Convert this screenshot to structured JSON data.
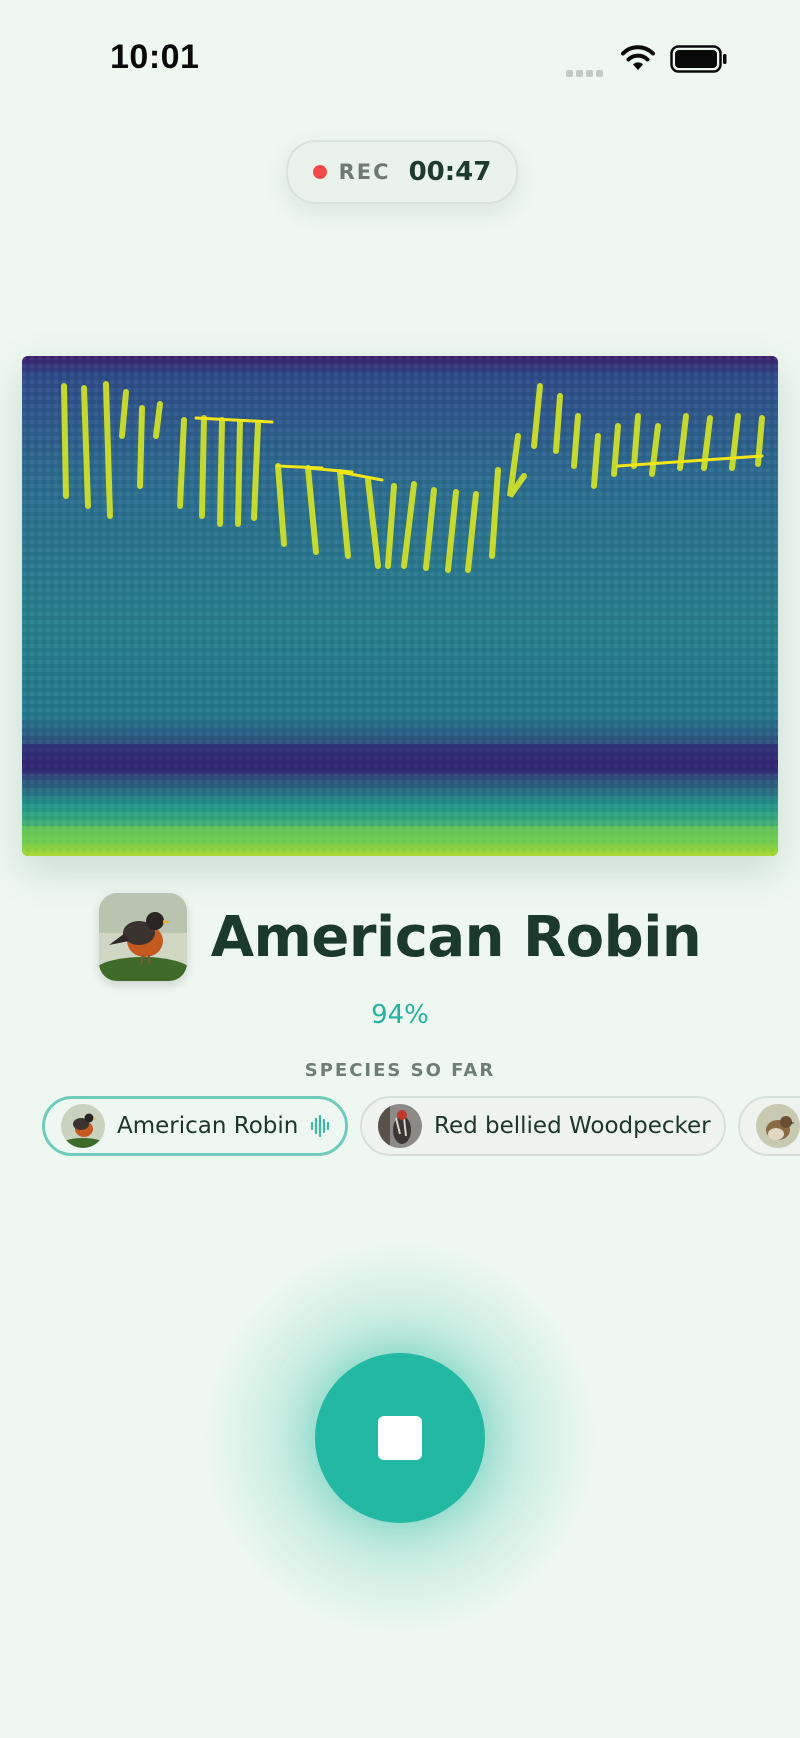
{
  "status_bar": {
    "time": "10:01",
    "icons": [
      "signal-icon",
      "wifi-icon",
      "battery-icon"
    ]
  },
  "recording": {
    "label": "REC",
    "elapsed": "00:47",
    "indicator_color": "#f04a4a"
  },
  "detection": {
    "species": "American Robin",
    "confidence": "94%",
    "thumbnail_icon": "robin-photo"
  },
  "species_so_far": {
    "title": "SPECIES SO FAR",
    "items": [
      {
        "name": "American Robin",
        "avatar": "robin-photo",
        "active": true
      },
      {
        "name": "Red bellied Woodpecker",
        "avatar": "woodpecker-photo",
        "active": false
      },
      {
        "name": "",
        "avatar": "sparrow-photo",
        "active": false
      }
    ]
  },
  "controls": {
    "stop_icon": "stop-icon",
    "accent_color": "#23b8a2"
  },
  "colors": {
    "background": "#eef8f0",
    "accent": "#23b8a2",
    "text_dark": "#1b3a2b"
  }
}
